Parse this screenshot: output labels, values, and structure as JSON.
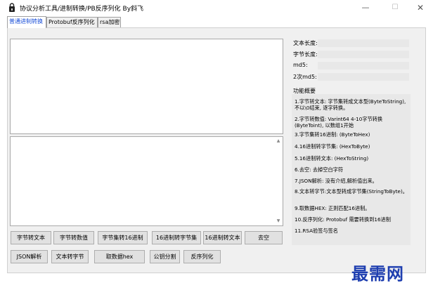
{
  "window": {
    "title": "协议分析工具/进制转换/PB反序列化  By斜飞",
    "min_glyph": "—",
    "max_glyph": "☐",
    "close_glyph": "✕"
  },
  "tabs": [
    {
      "label": "普通进制转换",
      "active": true
    },
    {
      "label": "Protobuf反序列化",
      "active": false
    },
    {
      "label": "rsa加密",
      "active": false
    }
  ],
  "input_box": {
    "value": ""
  },
  "output_box": {
    "value": ""
  },
  "buttons": {
    "row1": [
      "字节转文本",
      "字节转数值",
      "字节集转16进制",
      "16进制转字节集",
      "16进制转文本",
      "去空"
    ],
    "row2": [
      "JSON解析",
      "文本转字节",
      "取数据hex",
      "公钥分割",
      "反序列化"
    ]
  },
  "info": {
    "text_length": "文本长度:",
    "byte_length": "字节长度:",
    "md5": "md5:",
    "md5_twice": "2次md5:"
  },
  "summary": {
    "title": "功能概要",
    "items": [
      "1.字节转文本: 字节集转成文本型(ByteToString), 不以\\0结束, 逐字转换。",
      "2.字节转数值: Varint64  4-10字节转换(ByteToint), 以数组1开始",
      "3.字节集转16进制: (ByteToHex)",
      "4.16进制转字节集: (HexToByte)",
      "5.16进制转文本: (HexToString)",
      "6.去空: 去掉空白字符",
      "7.JSON解析: 没有介绍,解析值出来。",
      "8.文本转字节:文本型转成字节集(StringToByte)。",
      "9.取数据HEX: 正则匹配16进制。",
      "10.反序列化: Protobuf 需要转换到16进制",
      "11.RSA验签与签名"
    ]
  },
  "watermark": "最需网",
  "colors": {
    "accent": "#1a4fd8",
    "watermark": "#1f3fb0"
  }
}
